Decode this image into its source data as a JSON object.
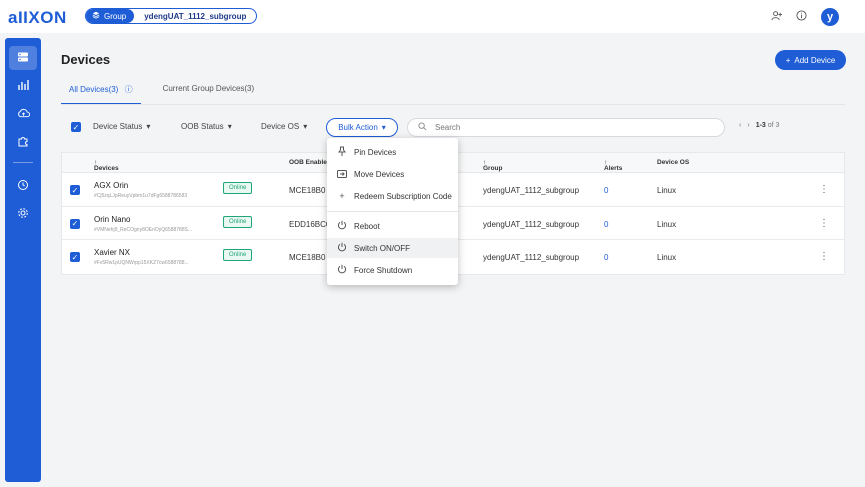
{
  "app": {
    "logo": "aIIXON"
  },
  "group_selector": {
    "label": "Group",
    "name": "ydengUAT_1112_subgroup"
  },
  "user": {
    "initial": "y"
  },
  "page": {
    "title": "Devices",
    "add_button": "Add Device"
  },
  "tabs": [
    {
      "label": "All Devices(3)",
      "active": true
    },
    {
      "label": "Current Group Devices(3)",
      "active": false
    }
  ],
  "filters": {
    "device_status": "Device Status",
    "oob_status": "OOB Status",
    "device_os": "Device OS",
    "bulk_action": "Bulk Action"
  },
  "search": {
    "placeholder": "Search"
  },
  "pagination": {
    "range": "1-3",
    "of": "of 3"
  },
  "table": {
    "columns": {
      "devices": "Devices",
      "oob": "OOB Enablers",
      "group": "Group",
      "alerts": "Alerts",
      "os": "Device OS"
    },
    "rows": [
      {
        "name": "AGX Orin",
        "id": "#Cj5zqLJpReuyVpbm1u7dFg6588786583",
        "status": "Online",
        "oob": "MCE18B0",
        "group": "ydengUAT_1112_subgroup",
        "alerts": "0",
        "os": "Linux"
      },
      {
        "name": "Orin Nano",
        "id": "#VMNehj9_ReCOgny8OEnOyQ6588788S...",
        "status": "Online",
        "oob": "EDD16BC0",
        "group": "ydengUAT_1112_subgroup",
        "alerts": "0",
        "os": "Linux"
      },
      {
        "name": "Xavier NX",
        "id": "#Fv5Rw1pUQNWrpp15XKZ7cw6588788...",
        "status": "Online",
        "oob": "MCE18B0",
        "group": "ydengUAT_1112_subgroup",
        "alerts": "0",
        "os": "Linux"
      }
    ]
  },
  "bulk_menu": {
    "items": [
      {
        "label": "Pin Devices",
        "icon": "pin-icon"
      },
      {
        "label": "Move Devices",
        "icon": "move-icon"
      },
      {
        "label": "Redeem Subscription Code",
        "icon": "plus-icon"
      },
      {
        "label": "Reboot",
        "icon": "power-icon"
      },
      {
        "label": "Switch ON/OFF",
        "icon": "power-icon"
      },
      {
        "label": "Force Shutdown",
        "icon": "power-icon"
      }
    ]
  },
  "colors": {
    "accent": "#1e5dd6",
    "online": "#1fa67a"
  }
}
